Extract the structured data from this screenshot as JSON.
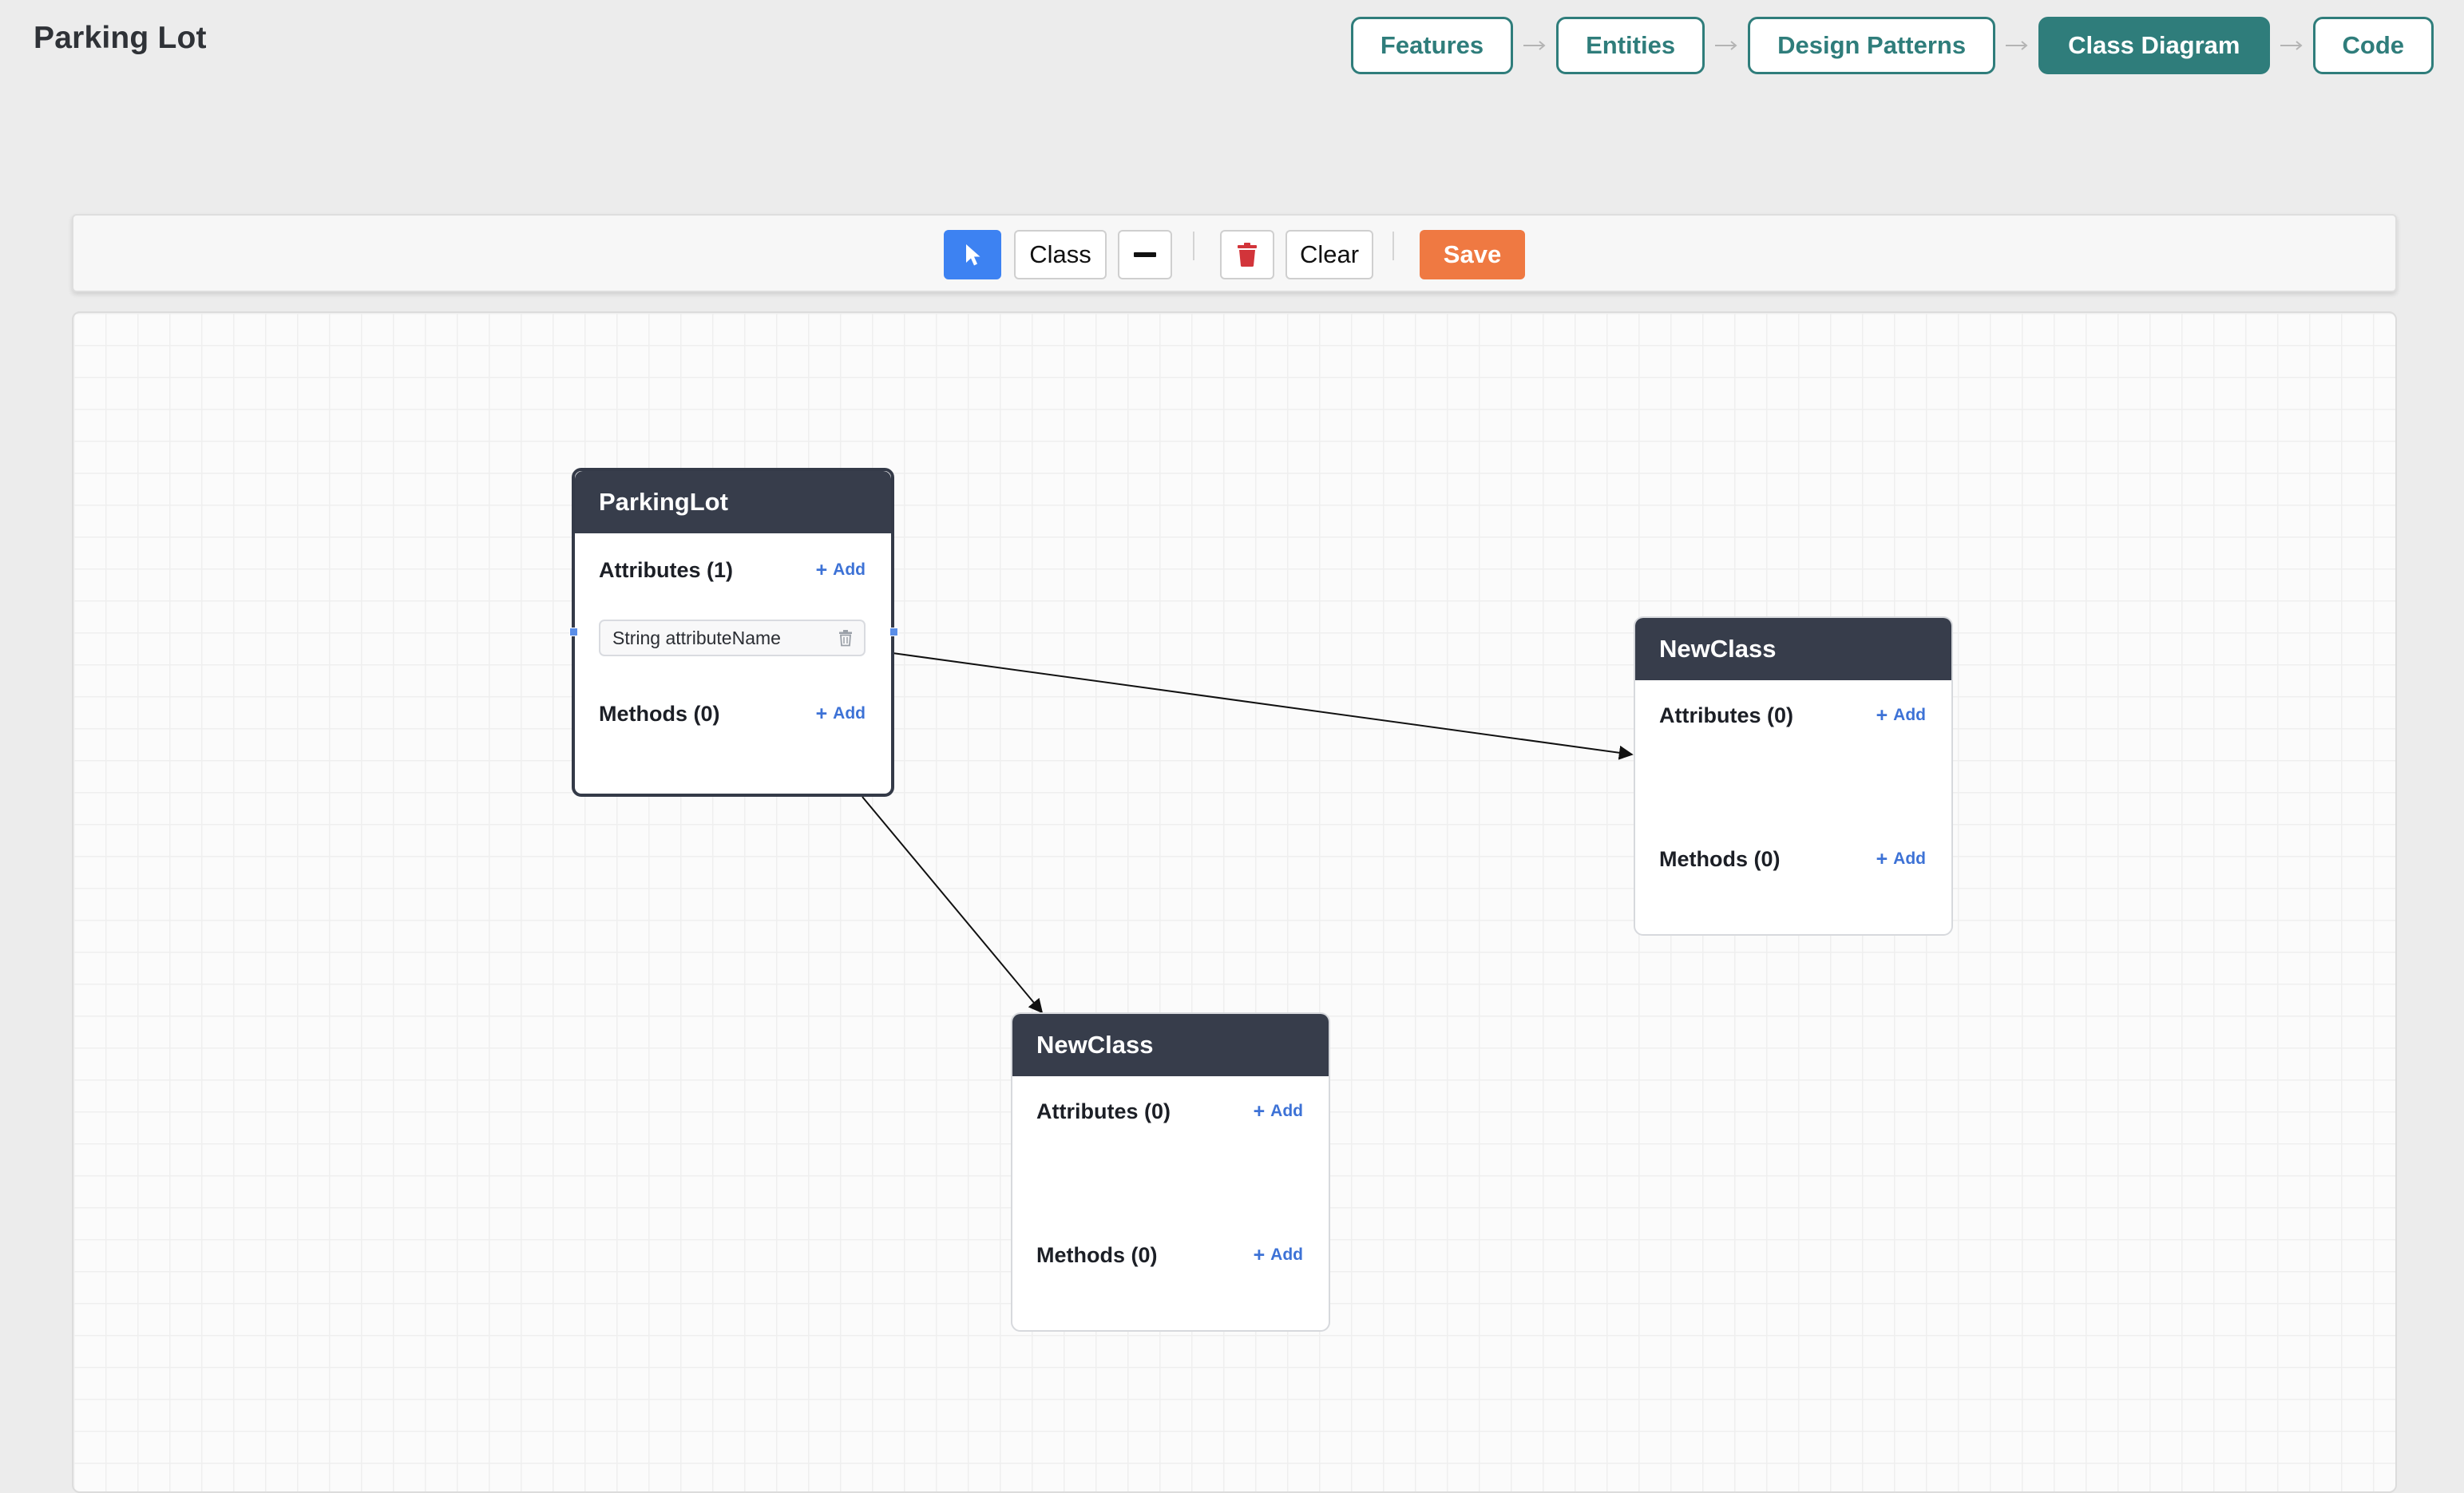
{
  "app": {
    "title": "Parking Lot"
  },
  "steps": [
    {
      "label": "Features",
      "active": false
    },
    {
      "label": "Entities",
      "active": false
    },
    {
      "label": "Design Patterns",
      "active": false
    },
    {
      "label": "Class Diagram",
      "active": true
    },
    {
      "label": "Code",
      "active": false
    }
  ],
  "toolbar": {
    "select_tool_icon": "cursor-arrow-icon",
    "class_label": "Class",
    "connector_icon": "line-icon",
    "delete_icon": "trash-icon",
    "clear_label": "Clear",
    "save_label": "Save"
  },
  "diagram": {
    "classes": [
      {
        "name": "ParkingLot",
        "selected": true,
        "attributes_title": "Attributes (1)",
        "attributes": [
          "String attributeName"
        ],
        "methods_title": "Methods (0)",
        "methods": []
      },
      {
        "name": "NewClass",
        "selected": false,
        "attributes_title": "Attributes (0)",
        "attributes": [],
        "methods_title": "Methods (0)",
        "methods": []
      },
      {
        "name": "NewClass",
        "selected": false,
        "attributes_title": "Attributes (0)",
        "attributes": [],
        "methods_title": "Methods (0)",
        "methods": []
      }
    ],
    "add_label": "Add",
    "relationships": [
      {
        "from": "ParkingLot",
        "to": "NewClass (right)",
        "type": "arrow"
      },
      {
        "from": "ParkingLot",
        "to": "NewClass (bottom)",
        "type": "arrow"
      }
    ]
  },
  "colors": {
    "accent": "#2f7d7b",
    "class_header": "#373d4b",
    "select_tool": "#3d82f2",
    "save_button": "#ef7942",
    "delete_icon": "#d2343a",
    "add_link": "#3d72d6"
  }
}
